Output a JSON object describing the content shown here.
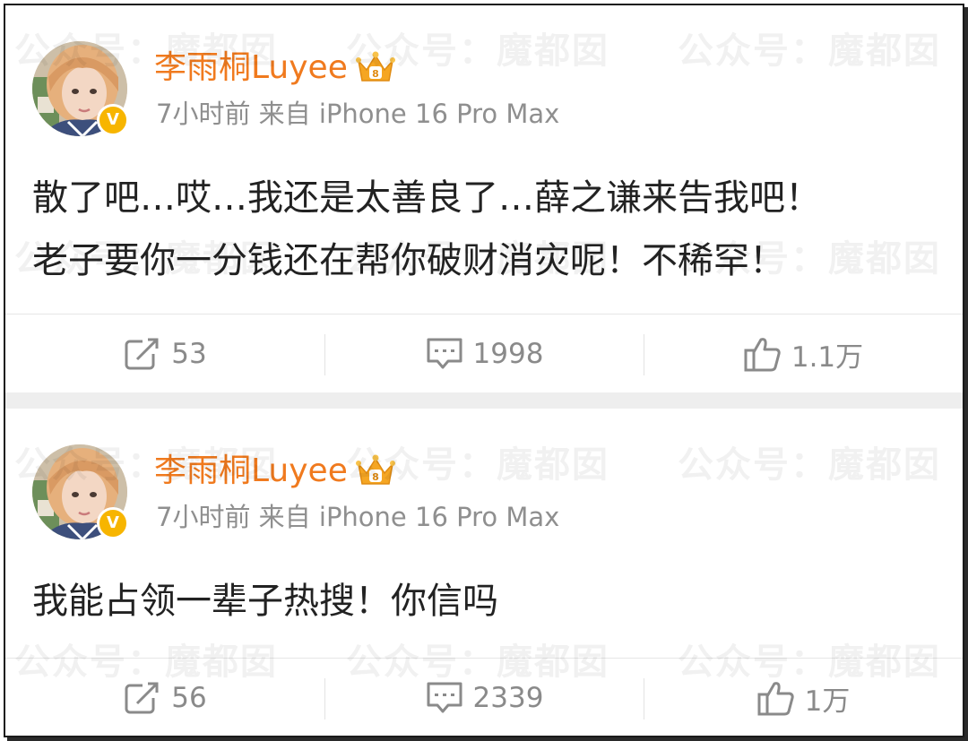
{
  "colors": {
    "username": "#f07a1e",
    "meta": "#8f8f8f",
    "content": "#222222",
    "action": "#8a8a8a",
    "verify": "#f7b500",
    "separator": "#eeeeee"
  },
  "watermark": "公众号：魔都囡",
  "posts": [
    {
      "username": "李雨桐Luyee",
      "meta": "7小时前 来自 iPhone 16 Pro Max",
      "badge_icon": "crown-vip-icon",
      "verify_mark": "V",
      "content_lines": [
        "散了吧…哎…我还是太善良了…薛之谦来告我吧！",
        "老子要你一分钱还在帮你破财消灾呢！不稀罕！"
      ],
      "actions": {
        "repost": "53",
        "comment": "1998",
        "like": "1.1万"
      }
    },
    {
      "username": "李雨桐Luyee",
      "meta": "7小时前 来自 iPhone 16 Pro Max",
      "badge_icon": "crown-vip-icon",
      "verify_mark": "V",
      "content_lines": [
        "我能占领一辈子热搜！你信吗"
      ],
      "actions": {
        "repost": "56",
        "comment": "2339",
        "like": "1万"
      }
    }
  ]
}
